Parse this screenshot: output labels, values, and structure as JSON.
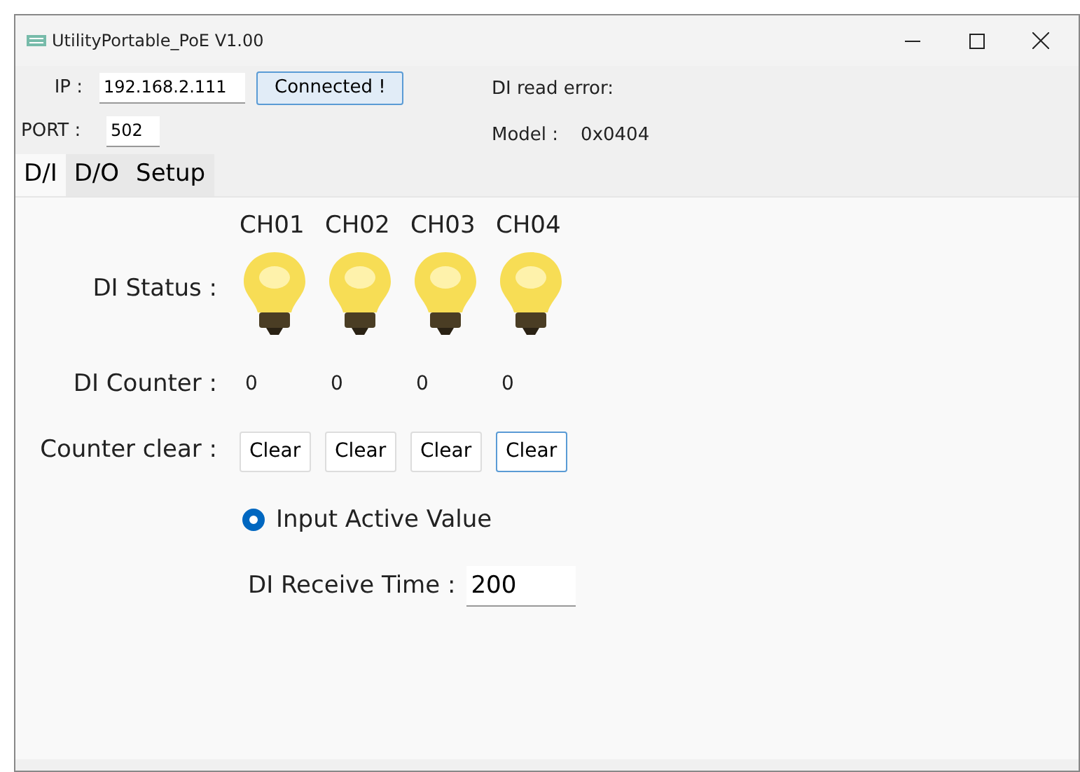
{
  "window": {
    "title": "UtilityPortable_PoE V1.00"
  },
  "connection": {
    "ip_label": "IP :",
    "ip": "192.168.2.111",
    "connect_button": "Connected !",
    "port_label": "PORT :",
    "port": "502",
    "error_label": "DI read error:",
    "model_label": "Model :",
    "model": "0x0404"
  },
  "tabs": [
    {
      "label": "D/I",
      "selected": true
    },
    {
      "label": "D/O",
      "selected": false
    },
    {
      "label": "Setup",
      "selected": false
    }
  ],
  "di": {
    "status_label": "DI Status :",
    "counter_label": "DI Counter :",
    "clear_label": "Counter clear :",
    "channels": [
      {
        "name": "CH01",
        "on": true,
        "counter": "0",
        "clear": "Clear",
        "focused": false
      },
      {
        "name": "CH02",
        "on": true,
        "counter": "0",
        "clear": "Clear",
        "focused": false
      },
      {
        "name": "CH03",
        "on": true,
        "counter": "0",
        "clear": "Clear",
        "focused": false
      },
      {
        "name": "CH04",
        "on": true,
        "counter": "0",
        "clear": "Clear",
        "focused": true
      }
    ],
    "active_value": {
      "label": "Input Active Value",
      "checked": true
    },
    "receive_time_label": "DI Receive Time :",
    "receive_time": "200"
  }
}
